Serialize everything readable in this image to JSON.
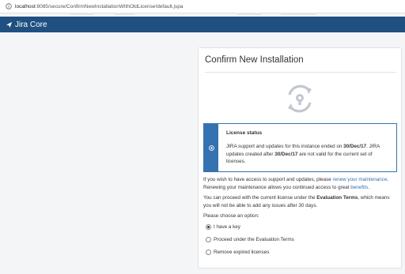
{
  "browser": {
    "url_host": "localhost",
    "url_path": ":8085/secure/ConfirmNewInstallationWithOldLicense!default.jspa"
  },
  "header": {
    "product_name": "Jira Core",
    "brand_color": "#205081"
  },
  "panel": {
    "title": "Confirm New Installation",
    "message": {
      "title": "License status",
      "body_prefix": "JIRA support and updates for this instance ended on ",
      "date1": "30/Dec/17",
      "body_mid": ". JIRA updates created after ",
      "date2": "30/Dec/17",
      "body_suffix": " are not valid for the current set of licenses.",
      "accent_color": "#3572b0"
    },
    "para1": {
      "prefix": "If you wish to have access to support and updates, please ",
      "link1": "renew your maintenance",
      "mid": ". Renewing your maintenance allows you continued access to great ",
      "link2": "benefits",
      "suffix": "."
    },
    "para2": {
      "prefix": "You can proceed with the current license under the ",
      "bold": "Evaluation Terms",
      "suffix": ", which means you will not be able to add any issues after 30 days."
    },
    "choose_label": "Please choose an option:",
    "options": [
      {
        "label": "I have a key",
        "checked": true
      },
      {
        "label": "Proceed under the Evaluation Terms",
        "checked": false
      },
      {
        "label": "Remove expired licenses",
        "checked": false
      }
    ]
  }
}
